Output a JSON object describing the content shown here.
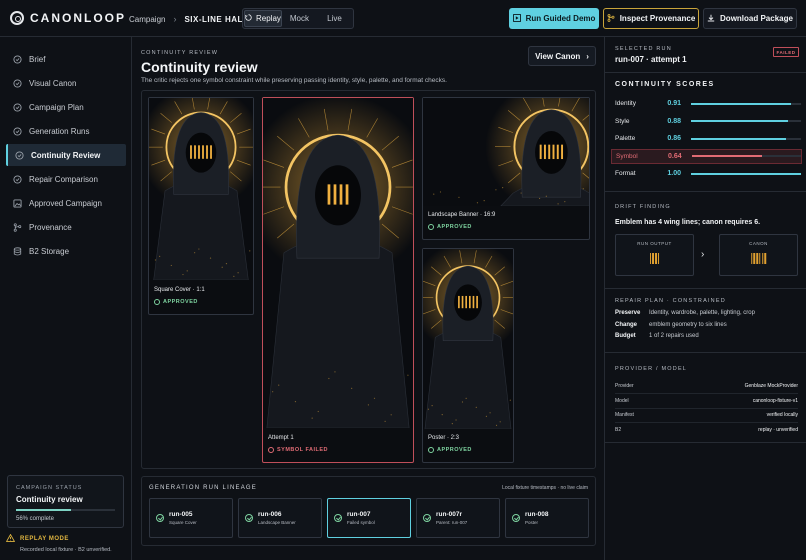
{
  "app": {
    "name": "CANONLOOP"
  },
  "breadcrumb": {
    "parent": "Campaign",
    "current": "SIX-LINE HALO"
  },
  "modes": [
    {
      "label": "Replay",
      "active": true
    },
    {
      "label": "Mock",
      "active": false
    },
    {
      "label": "Live",
      "active": false
    }
  ],
  "toolbar": {
    "run_demo": "Run Guided Demo",
    "inspect": "Inspect Provenance",
    "download": "Download Package"
  },
  "sidebar": {
    "items": [
      {
        "label": "Brief",
        "icon": "circle-icon"
      },
      {
        "label": "Visual Canon",
        "icon": "circle-icon"
      },
      {
        "label": "Campaign Plan",
        "icon": "circle-icon"
      },
      {
        "label": "Generation Runs",
        "icon": "circle-icon"
      },
      {
        "label": "Continuity Review",
        "icon": "circle-icon",
        "active": true
      },
      {
        "label": "Repair Comparison",
        "icon": "circle-icon"
      },
      {
        "label": "Approved Campaign",
        "icon": "image-icon"
      },
      {
        "label": "Provenance",
        "icon": "branch-icon"
      },
      {
        "label": "B2 Storage",
        "icon": "database-icon"
      }
    ],
    "status": {
      "eyebrow": "CAMPAIGN STATUS",
      "title": "Continuity review",
      "progress": 0.56,
      "progress_text": "56% complete"
    },
    "replay": {
      "title": "REPLAY MODE",
      "subtitle": "Recorded local fixture · B2 unverified."
    }
  },
  "main": {
    "eyebrow": "CONTINUITY REVIEW",
    "title": "Continuity review",
    "subtitle": "The critic rejects one symbol constraint while preserving passing identity, style, palette, and format checks.",
    "view_canon": "View Canon",
    "cards": [
      {
        "label": "Square Cover · 1:1",
        "status": "APPROVED",
        "ok": true
      },
      {
        "label": "Attempt 1",
        "status": "SYMBOL FAILED",
        "ok": false
      },
      {
        "label": "Landscape Banner · 16:9",
        "status": "APPROVED",
        "ok": true
      },
      {
        "label": "Poster · 2:3",
        "status": "APPROVED",
        "ok": true
      }
    ],
    "lineage": {
      "title": "GENERATION RUN LINEAGE",
      "note": "Local fixture timestamps · no live claim",
      "runs": [
        {
          "id": "run-005",
          "sub": "Square Cover"
        },
        {
          "id": "run-006",
          "sub": "Landscape Banner"
        },
        {
          "id": "run-007",
          "sub": "Failed symbol",
          "active": true
        },
        {
          "id": "run-007r",
          "sub": "Parent: run-007"
        },
        {
          "id": "run-008",
          "sub": "Poster"
        }
      ]
    }
  },
  "panel": {
    "selected_eyebrow": "SELECTED RUN",
    "selected_run": "run-007 · attempt 1",
    "badge": "FAILED",
    "scores_title": "CONTINUITY SCORES",
    "scores": [
      {
        "name": "Identity",
        "value": 0.91
      },
      {
        "name": "Style",
        "value": 0.88
      },
      {
        "name": "Palette",
        "value": 0.86
      },
      {
        "name": "Symbol",
        "value": 0.64,
        "failed": true
      },
      {
        "name": "Format",
        "value": 1.0
      }
    ],
    "score_texts": [
      "0.91",
      "0.88",
      "0.86",
      "0.64",
      "1.00"
    ],
    "drift_eyebrow": "DRIFT FINDING",
    "drift_text": "Emblem has 4 wing lines; canon requires 6.",
    "run_output_label": "RUN OUTPUT",
    "canon_label": "CANON",
    "run_output_lines": 4,
    "canon_lines": 6,
    "repair_eyebrow": "REPAIR PLAN · CONSTRAINED",
    "repair": [
      {
        "k": "Preserve",
        "v": "Identity, wardrobe, palette, lighting, crop"
      },
      {
        "k": "Change",
        "v": "emblem geometry to six lines"
      },
      {
        "k": "Budget",
        "v": "1 of 2 repairs used"
      }
    ],
    "provider_eyebrow": "PROVIDER / MODEL",
    "provider": [
      {
        "k": "Provider",
        "v": "Genblaze MockProvider"
      },
      {
        "k": "Model",
        "v": "canonloop-fixture-v1"
      },
      {
        "k": "Manifest",
        "v": "verified locally"
      },
      {
        "k": "B2",
        "v": "replay · unverified"
      }
    ]
  },
  "colors": {
    "accent": "#5fd0e0",
    "gold": "#c9a43a",
    "ok": "#7ed3a0",
    "fail": "#e06b74"
  }
}
